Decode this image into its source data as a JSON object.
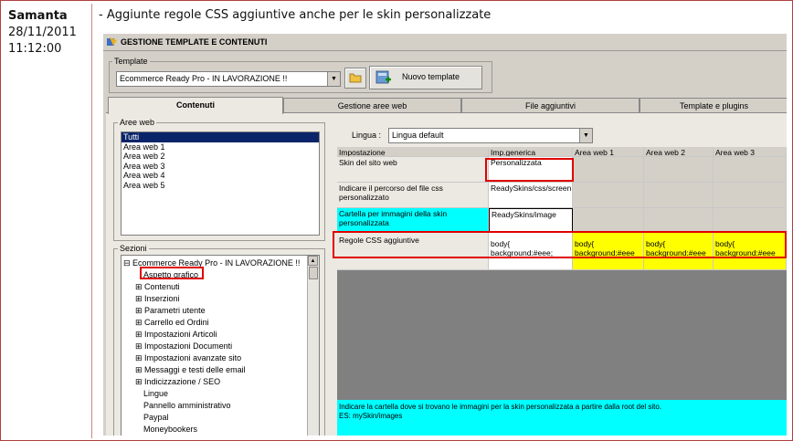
{
  "post": {
    "author": "Samanta",
    "date": "28/11/2011",
    "time": "11:12:00",
    "text": "- Aggiunte regole CSS aggiuntive anche per le skin personalizzate"
  },
  "window": {
    "title": "GESTIONE TEMPLATE E CONTENUTI"
  },
  "template": {
    "group_label": "Template",
    "selected": "Ecommerce Ready Pro - IN LAVORAZIONE !!",
    "new_button": "Nuovo template"
  },
  "tabs": [
    "Contenuti",
    "Gestione aree web",
    "File aggiuntivi",
    "Template e plugins"
  ],
  "aree_web": {
    "label": "Aree web",
    "items": [
      "Tutti",
      "Area web 1",
      "Area web 2",
      "Area web 3",
      "Area web 4",
      "Area web 5"
    ]
  },
  "sezioni": {
    "label": "Sezioni",
    "root": "Ecommerce Ready Pro - IN LAVORAZIONE !!",
    "items": [
      "Aspetto grafico",
      "Contenuti",
      "Inserzioni",
      "Parametri utente",
      "Carrello ed Ordini",
      "Impostazioni Articoli",
      "Impostazioni Documenti",
      "Impostazioni avanzate sito",
      "Messaggi e testi delle email",
      "Indicizzazione / SEO",
      "Lingue",
      "Pannello amministrativo",
      "Paypal",
      "Moneybookers"
    ]
  },
  "lingua": {
    "label": "Lingua :",
    "value": "Lingua default"
  },
  "grid": {
    "headers": [
      "Impostazione",
      "Imp.generica",
      "Area web 1",
      "Area web 2",
      "Area web 3"
    ],
    "rows": [
      {
        "name": "Skin del sito web",
        "generic": "Personalizzata",
        "a1": "",
        "a2": "",
        "a3": ""
      },
      {
        "name": "Indicare il percorso del file css personalizzato",
        "generic": "ReadySkins/css/screen.css",
        "a1": "",
        "a2": "",
        "a3": ""
      },
      {
        "name": "Cartella per immagini della skin personalizzata",
        "generic": "ReadySkins/image",
        "a1": "",
        "a2": "",
        "a3": ""
      },
      {
        "name": "Regole CSS aggiuntive",
        "generic": "body{ background:#eee;",
        "a1": "body{ background:#eee",
        "a2": "body{ background:#eee",
        "a3": "body{ background:#eee"
      }
    ]
  },
  "description": {
    "line1": "Indicare la cartella dove si trovano le immagini per la skin personalizzata a partire dalla root del sito.",
    "line2": "ES: mySkin/images"
  },
  "colors": {
    "highlight_red": "#e00000",
    "cyan": "#00ffff",
    "yellow": "#ffff00",
    "selection": "#0a246a"
  }
}
